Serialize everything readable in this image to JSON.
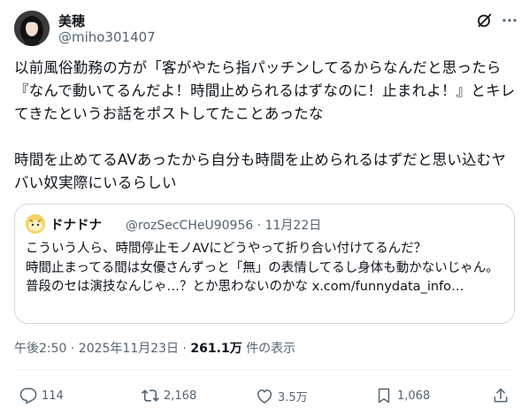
{
  "author": {
    "display_name": "美穂",
    "handle": "@miho301407"
  },
  "post": {
    "text": "以前風俗勤務の方が「客がやたら指パッチンしてるからなんだと思ったら『なんで動いてるんだよ！時間止められるはずなのに！止まれよ！』とキレてきたというお話をポストしてたことあったな\n\n時間を止めてるAVあったから自分も時間を止められるはずだと思い込むヤバい奴実際にいるらしい",
    "timestamp": "午後2:50 · 2025年11月23日 · ",
    "views_count": "261.1万",
    "views_label": " 件の表示"
  },
  "quote": {
    "display_name": "ドナドナ",
    "handle_date": "@rozSecCHeU90956 · 11月22日",
    "text": "こういう人ら、時間停止モノAVにどうやって折り合い付けてるんだ？\n時間止まってる間は女優さんずっと「無」の表情してるし身体も動かないじゃん。\n普段のセは演技なんじゃ…？とか思わないのかな x.com/funnydata_info…"
  },
  "actions": {
    "replies": "114",
    "reposts": "2,168",
    "likes": "3.5万",
    "bookmarks": "1,068"
  },
  "icons": [
    "avatar",
    "grok-icon",
    "more-icon",
    "reply-icon",
    "repost-icon",
    "like-icon",
    "bookmark-icon",
    "share-icon"
  ],
  "colors": {
    "text": "#0f1419",
    "secondary": "#536471",
    "border": "#cfd9de"
  }
}
